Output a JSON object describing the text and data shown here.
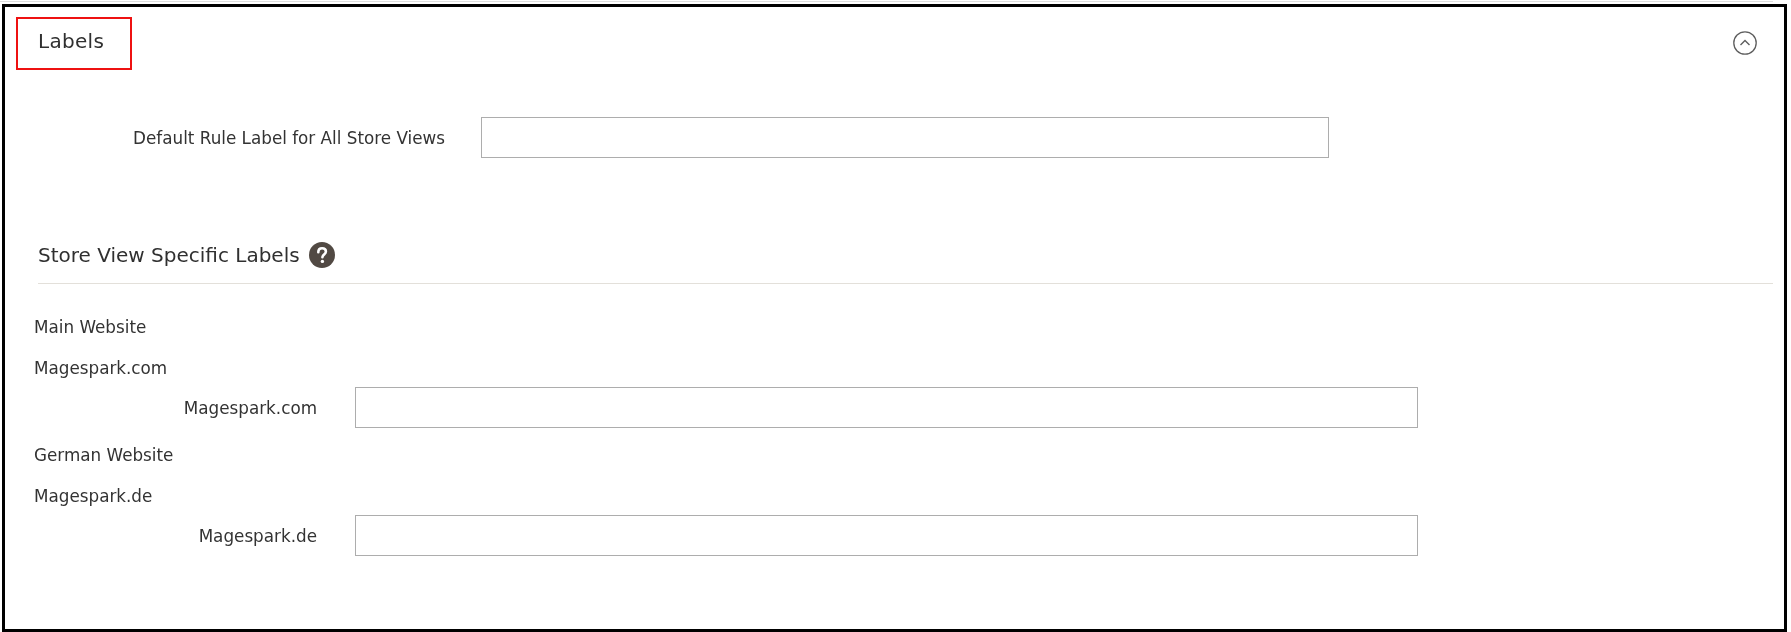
{
  "section": {
    "title": "Labels",
    "title_highlighted": true,
    "expanded": true
  },
  "default_label": {
    "label": "Default Rule Label for All Store Views"
  },
  "store_view_labels": {
    "title": "Store View Specific Labels",
    "websites": [
      {
        "name": "Main Website",
        "stores": [
          {
            "name": "Magespark.com",
            "views": [
              {
                "label": "Magespark.com"
              }
            ]
          }
        ]
      },
      {
        "name": "German Website",
        "stores": [
          {
            "name": "Magespark.de",
            "views": [
              {
                "label": "Magespark.de"
              }
            ]
          }
        ]
      }
    ]
  }
}
